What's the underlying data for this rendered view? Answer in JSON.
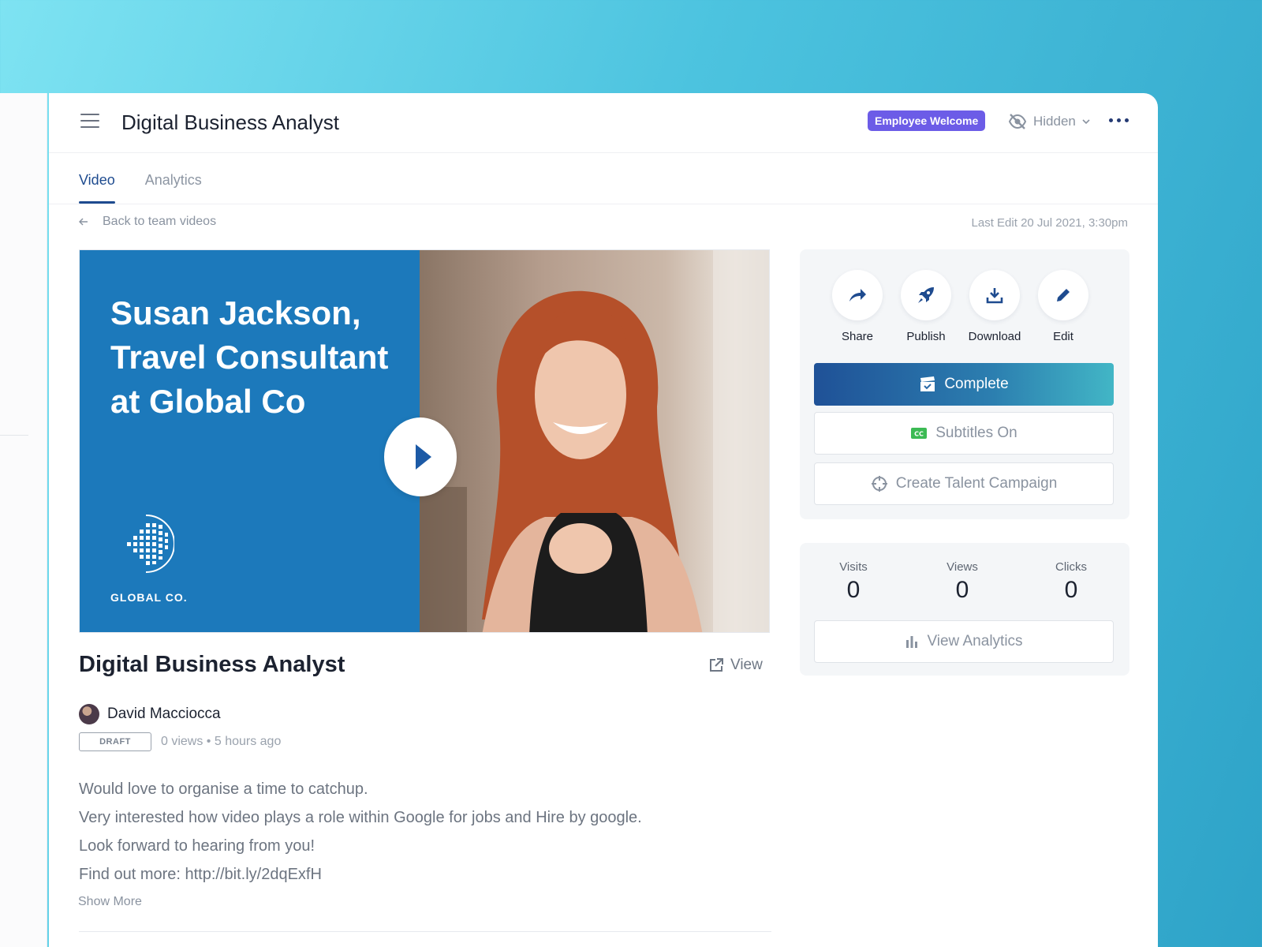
{
  "header": {
    "title": "Digital Business Analyst",
    "team_badge": "Employee Welcome",
    "visibility": "Hidden"
  },
  "tabs": [
    {
      "label": "Video",
      "active": true
    },
    {
      "label": "Analytics",
      "active": false
    }
  ],
  "back_link": "Back to team videos",
  "last_edit": "Last Edit 20 Jul 2021, 3:30pm",
  "video": {
    "headline": "Susan Jackson, Travel Consultant at Global Co",
    "logo_text": "GLOBAL CO."
  },
  "details": {
    "title": "Digital Business Analyst",
    "view_label": "View",
    "author": "David Macciocca",
    "status": "DRAFT",
    "meta": "0 views • 5 hours ago",
    "description": [
      "Would love to organise a time to catchup.",
      "Very interested how video plays a role within Google for jobs and Hire by google.",
      "Look forward to hearing from you!",
      "Find out more: http://bit.ly/2dqExfH"
    ],
    "show_more": "Show More"
  },
  "actions": [
    {
      "label": "Share",
      "icon": "share-icon"
    },
    {
      "label": "Publish",
      "icon": "rocket-icon"
    },
    {
      "label": "Download",
      "icon": "download-icon"
    },
    {
      "label": "Edit",
      "icon": "pencil-icon"
    }
  ],
  "buttons": {
    "complete": "Complete",
    "subtitles": "Subtitles On",
    "campaign": "Create Talent Campaign",
    "view_analytics": "View Analytics"
  },
  "stats": [
    {
      "label": "Visits",
      "value": "0"
    },
    {
      "label": "Views",
      "value": "0"
    },
    {
      "label": "Clicks",
      "value": "0"
    }
  ],
  "colors": {
    "accent": "#1e4b8f",
    "badge": "#6c5ce7",
    "video_panel": "#1c79bb",
    "cc_icon": "#3cba54"
  }
}
